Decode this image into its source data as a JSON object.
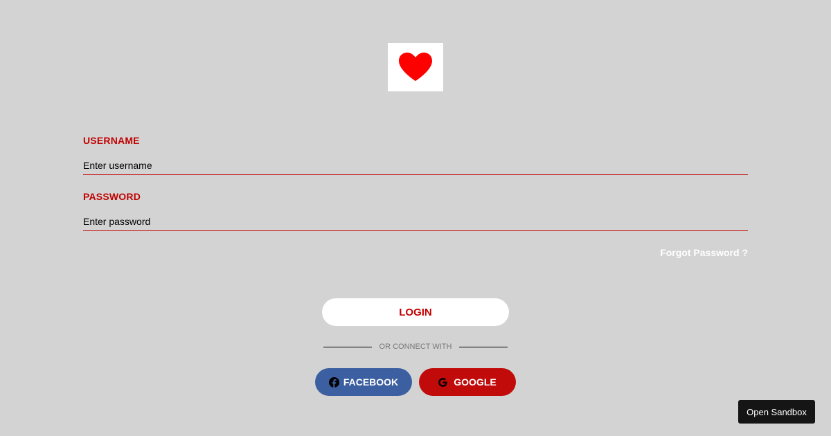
{
  "logo": {
    "icon": "heart-icon",
    "color": "#ff0000"
  },
  "form": {
    "username": {
      "label": "USERNAME",
      "placeholder": "Enter username"
    },
    "password": {
      "label": "PASSWORD",
      "placeholder": "Enter password"
    },
    "forgot_label": "Forgot Password ?",
    "login_label": "LOGIN"
  },
  "divider": {
    "text": "OR CONNECT WITH"
  },
  "social": {
    "facebook": {
      "label": "FACEBOOK",
      "icon": "facebook-icon",
      "color": "#3b5fa0"
    },
    "google": {
      "label": "GOOGLE",
      "icon": "google-icon",
      "color": "#c10a0a"
    }
  },
  "sandbox": {
    "label": "Open Sandbox"
  },
  "colors": {
    "background": "#d3d3d3",
    "accent": "#c20000"
  }
}
